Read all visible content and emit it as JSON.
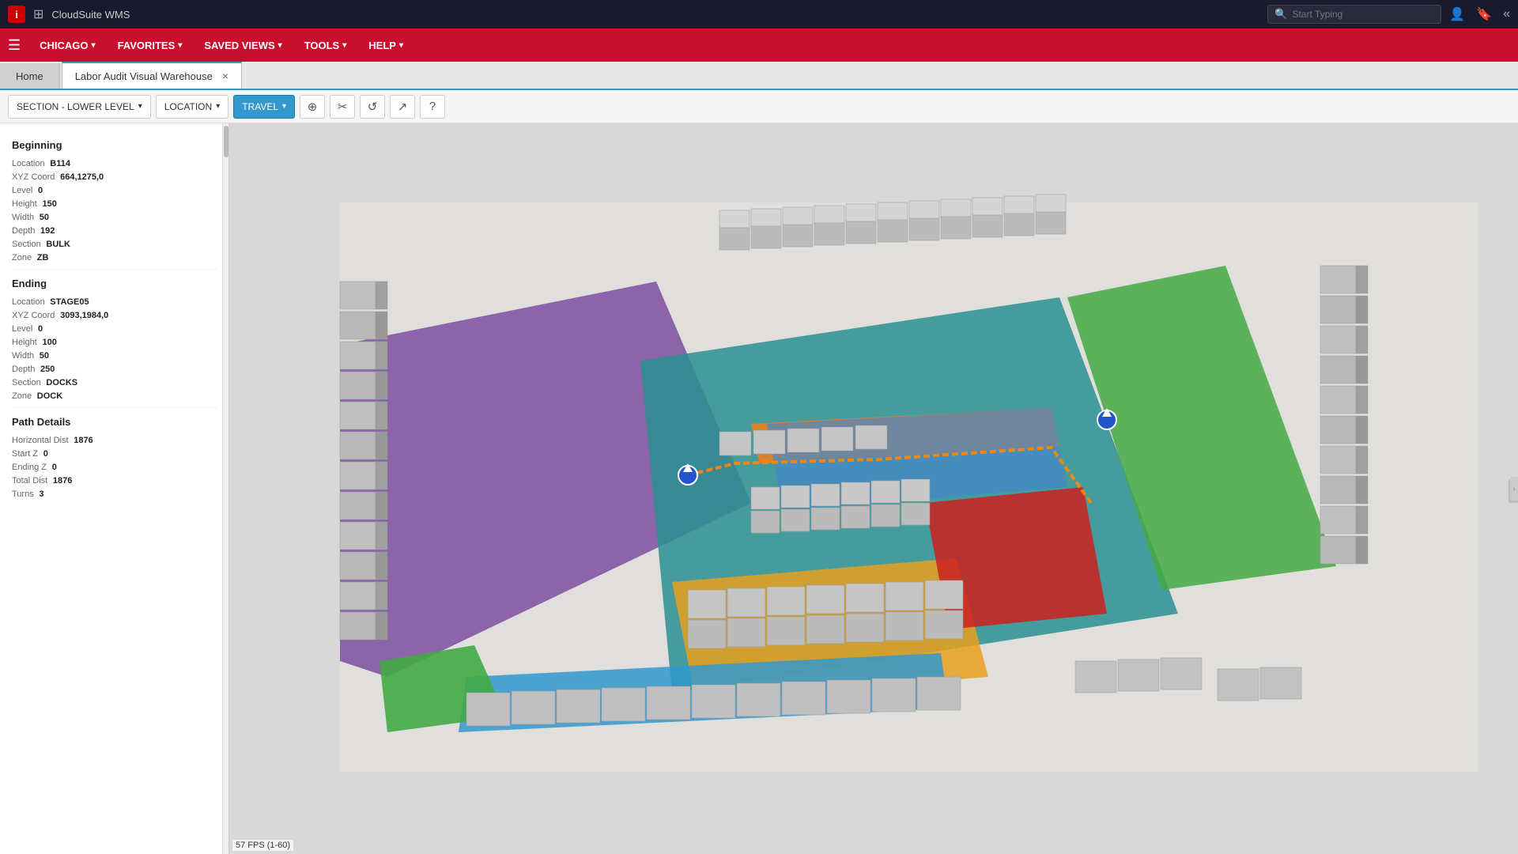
{
  "topbar": {
    "logo_letter": "i",
    "app_grid_icon": "⊞",
    "app_title": "CloudSuite WMS",
    "search_placeholder": "Start Typing",
    "user_icon": "👤",
    "bookmark_icon": "🔖",
    "collapse_icon": "«"
  },
  "navbar": {
    "hamburger": "☰",
    "items": [
      {
        "label": "CHICAGO",
        "caret": "▾",
        "id": "chicago"
      },
      {
        "label": "FAVORITES",
        "caret": "▾",
        "id": "favorites"
      },
      {
        "label": "SAVED VIEWS",
        "caret": "▾",
        "id": "saved-views"
      },
      {
        "label": "TOOLS",
        "caret": "▾",
        "id": "tools"
      },
      {
        "label": "HELP",
        "caret": "▾",
        "id": "help"
      }
    ]
  },
  "tabs": {
    "home_label": "Home",
    "active_label": "Labor Audit Visual Warehouse",
    "close_icon": "×"
  },
  "toolbar": {
    "section_btn": "SECTION - LOWER LEVEL",
    "location_btn": "LOCATION",
    "travel_btn": "TRAVEL",
    "icon1": "⊕",
    "icon2": "✂",
    "icon3": "↺",
    "icon4": "↗",
    "icon5": "?"
  },
  "sidebar": {
    "beginning_title": "Beginning",
    "beginning": {
      "location_label": "Location",
      "location_value": "B114",
      "xyz_label": "XYZ Coord",
      "xyz_value": "664,1275,0",
      "level_label": "Level",
      "level_value": "0",
      "height_label": "Height",
      "height_value": "150",
      "width_label": "Width",
      "width_value": "50",
      "depth_label": "Depth",
      "depth_value": "192",
      "section_label": "Section",
      "section_value": "BULK",
      "zone_label": "Zone",
      "zone_value": "ZB"
    },
    "ending_title": "Ending",
    "ending": {
      "location_label": "Location",
      "location_value": "STAGE05",
      "xyz_label": "XYZ Coord",
      "xyz_value": "3093,1984,0",
      "level_label": "Level",
      "level_value": "0",
      "height_label": "Height",
      "height_value": "100",
      "width_label": "Width",
      "width_value": "50",
      "depth_label": "Depth",
      "depth_value": "250",
      "section_label": "Section",
      "section_value": "DOCKS",
      "zone_label": "Zone",
      "zone_value": "DOCK"
    },
    "path_title": "Path Details",
    "path": {
      "hdist_label": "Horizontal Dist",
      "hdist_value": "1876",
      "startz_label": "Start Z",
      "startz_value": "0",
      "endz_label": "Ending Z",
      "endz_value": "0",
      "totaldist_label": "Total Dist",
      "totaldist_value": "1876",
      "turns_label": "Turns",
      "turns_value": "3"
    }
  },
  "fps": "57 FPS (1-60)"
}
